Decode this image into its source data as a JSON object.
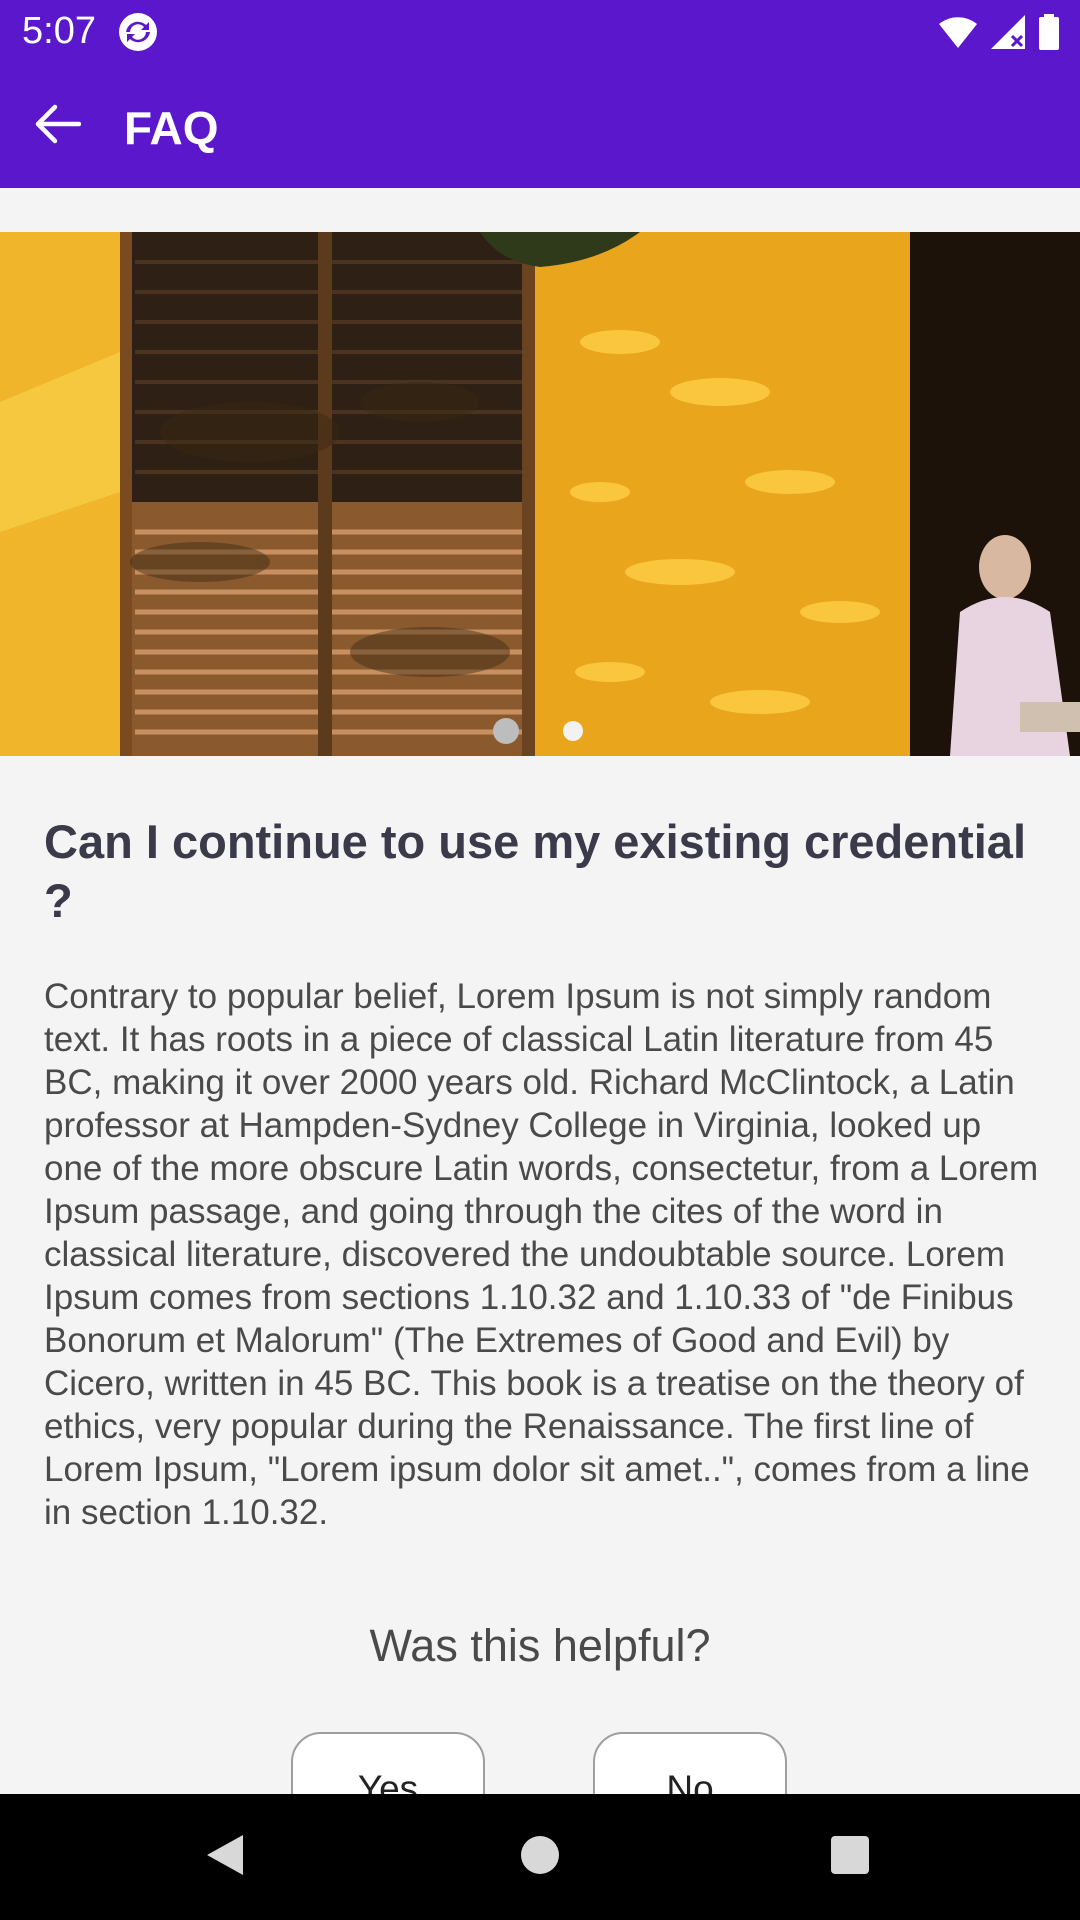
{
  "status_bar": {
    "time": "5:07",
    "app_icon": "sync-badge-icon",
    "icons": [
      "wifi-icon",
      "signal-icon",
      "battery-icon"
    ]
  },
  "app_bar": {
    "back_icon": "arrow-back-icon",
    "title": "FAQ",
    "background": "#5a17cb"
  },
  "hero_carousel": {
    "image": "yellow-building-with-shutters-photo",
    "page_count": 2,
    "active_page": 1
  },
  "faq": {
    "question": "Can I continue to use my existing credential ?",
    "answer": "Contrary to popular belief, Lorem Ipsum is not simply random text. It has roots in a piece of classical Latin literature from 45 BC, making it over 2000 years old. Richard McClintock, a Latin professor at Hampden-Sydney College in Virginia, looked up one of the more obscure Latin words, consectetur, from a Lorem Ipsum passage, and going through the cites of the word in classical literature, discovered the undoubtable source. Lorem Ipsum comes from sections 1.10.32 and 1.10.33 of \"de Finibus Bonorum et Malorum\" (The Extremes of Good and Evil) by Cicero, written in 45 BC. This book is a treatise on the theory of ethics, very popular during the Renaissance. The first line of Lorem Ipsum, \"Lorem ipsum dolor sit amet..\", comes from a line in section 1.10.32."
  },
  "feedback": {
    "prompt": "Was this helpful?",
    "yes_label": "Yes",
    "no_label": "No"
  },
  "nav_bar": {
    "buttons": [
      "back-triangle-icon",
      "home-circle-icon",
      "recents-square-icon"
    ]
  }
}
